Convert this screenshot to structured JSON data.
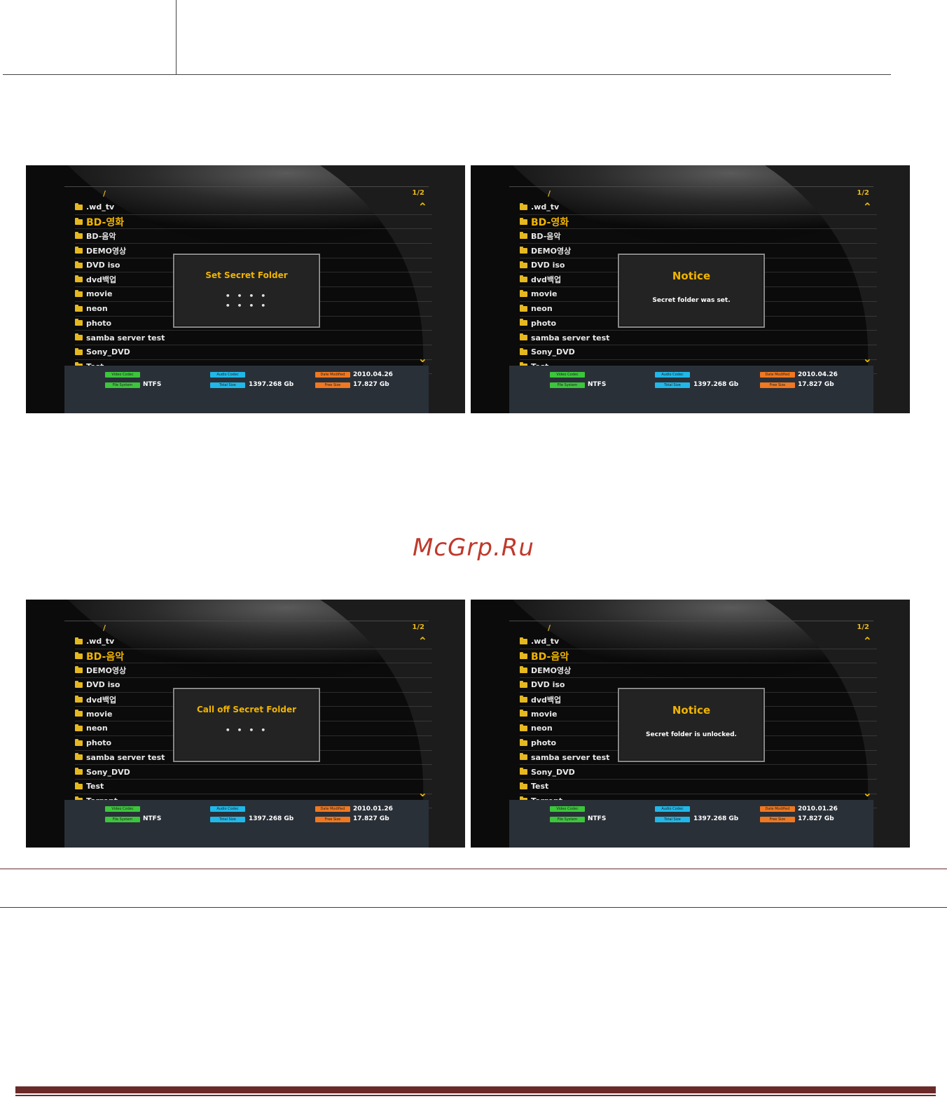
{
  "watermark": "McGrp.Ru",
  "screens": [
    {
      "path": "/",
      "page": "1/2",
      "items": [
        ".wd_tv",
        "BD-영화",
        "BD-음악",
        "DEMO영상",
        "DVD iso",
        "dvd백업",
        "movie",
        "neon",
        "photo",
        "samba server test",
        "Sony_DVD",
        "Test"
      ],
      "selected_index": 1,
      "dialog": {
        "title": "Set Secret Folder",
        "pw1": "• • • •",
        "pw2": "• • • •",
        "message": ""
      },
      "info": {
        "video_codec_label": "Video Codec",
        "audio_codec_label": "Audio Codec",
        "date_modified_label": "Date Modified",
        "file_system_label": "File System",
        "total_size_label": "Total Size",
        "free_size_label": "Free Size",
        "file_system": "NTFS",
        "total_size": "1397.268 Gb",
        "date_modified": "2010.04.26",
        "free_size": "17.827 Gb"
      }
    },
    {
      "path": "/",
      "page": "1/2",
      "items": [
        ".wd_tv",
        "BD-영화",
        "BD-음악",
        "DEMO영상",
        "DVD iso",
        "dvd백업",
        "movie",
        "neon",
        "photo",
        "samba server test",
        "Sony_DVD",
        "Test"
      ],
      "selected_index": 1,
      "dialog": {
        "title": "Notice",
        "pw1": "",
        "pw2": "",
        "message": "Secret folder was set."
      },
      "info": {
        "video_codec_label": "Video Codec",
        "audio_codec_label": "Audio Codec",
        "date_modified_label": "Date Modified",
        "file_system_label": "File System",
        "total_size_label": "Total Size",
        "free_size_label": "Free Size",
        "file_system": "NTFS",
        "total_size": "1397.268 Gb",
        "date_modified": "2010.04.26",
        "free_size": "17.827 Gb"
      }
    },
    {
      "path": "/",
      "page": "1/2",
      "items": [
        ".wd_tv",
        "BD-음악",
        "DEMO영상",
        "DVD iso",
        "dvd백업",
        "movie",
        "neon",
        "photo",
        "samba server test",
        "Sony_DVD",
        "Test",
        "Torrent"
      ],
      "selected_index": 1,
      "dialog": {
        "title": "Call off Secret Folder",
        "pw1": "• • • •",
        "pw2": "",
        "message": ""
      },
      "info": {
        "video_codec_label": "Video Codec",
        "audio_codec_label": "Audio Codec",
        "date_modified_label": "Date Modified",
        "file_system_label": "File System",
        "total_size_label": "Total Size",
        "free_size_label": "Free Size",
        "file_system": "NTFS",
        "total_size": "1397.268 Gb",
        "date_modified": "2010.01.26",
        "free_size": "17.827 Gb"
      }
    },
    {
      "path": "/",
      "page": "1/2",
      "items": [
        ".wd_tv",
        "BD-음악",
        "DEMO영상",
        "DVD iso",
        "dvd백업",
        "movie",
        "neon",
        "photo",
        "samba server test",
        "Sony_DVD",
        "Test",
        "Torrent"
      ],
      "selected_index": 1,
      "dialog": {
        "title": "Notice",
        "pw1": "",
        "pw2": "",
        "message": "Secret folder is unlocked."
      },
      "info": {
        "video_codec_label": "Video Codec",
        "audio_codec_label": "Audio Codec",
        "date_modified_label": "Date Modified",
        "file_system_label": "File System",
        "total_size_label": "Total Size",
        "free_size_label": "Free Size",
        "file_system": "NTFS",
        "total_size": "1397.268 Gb",
        "date_modified": "2010.01.26",
        "free_size": "17.827 Gb"
      }
    }
  ]
}
